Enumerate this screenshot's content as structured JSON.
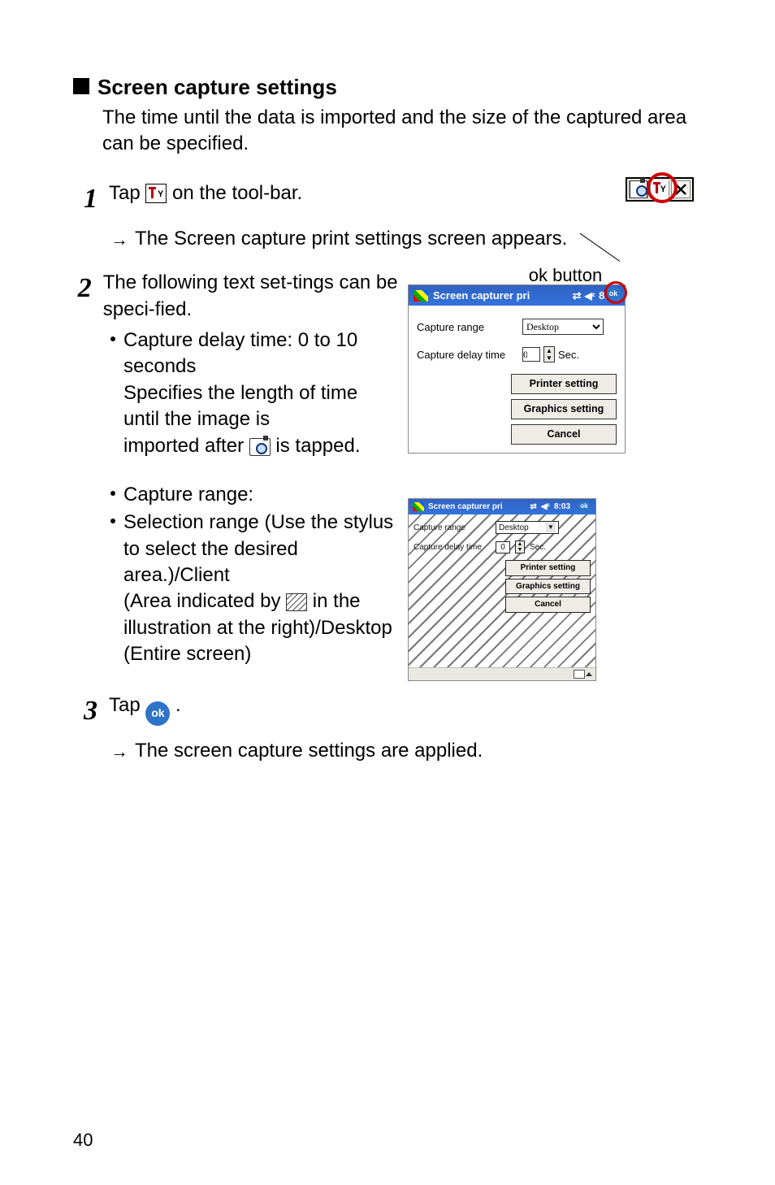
{
  "heading": "Screen capture settings",
  "intro": "The time until the data is imported and the size of the captured area can be specified.",
  "step1_a": "Tap ",
  "step1_b": " on the tool-bar.",
  "arrow1": "The Screen capture print settings screen appears.",
  "step2": "The following text set-tings can be speci-fied.",
  "bullets1": {
    "a_lead": "Capture delay time: 0 to 10 seconds",
    "a_desc1": "Specifies the length of time until the image is",
    "a_desc2_pre": "imported after ",
    "a_desc2_post": " is tapped."
  },
  "bullets2": {
    "a": "Capture range:",
    "b1": "Selection range (Use the stylus to select the desired area.)/Client",
    "b2_pre": "(Area indicated by",
    "b2_post": " in the illustration at the right)/Desktop (Entire screen)"
  },
  "step3_a": "Tap ",
  "step3_b": " .",
  "arrow3": "The screen capture settings are applied.",
  "ok_label": "ok button",
  "ok_text": "ok",
  "pda": {
    "title": "Screen capturer pri",
    "time": "8:03",
    "capture_range_lbl": "Capture range",
    "capture_range_val": "Desktop",
    "delay_lbl": "Capture delay time",
    "delay_val": "0",
    "sec": "Sec.",
    "printer_btn": "Printer setting",
    "graphics_btn": "Graphics setting",
    "cancel_btn": "Cancel"
  },
  "page_num": "40"
}
